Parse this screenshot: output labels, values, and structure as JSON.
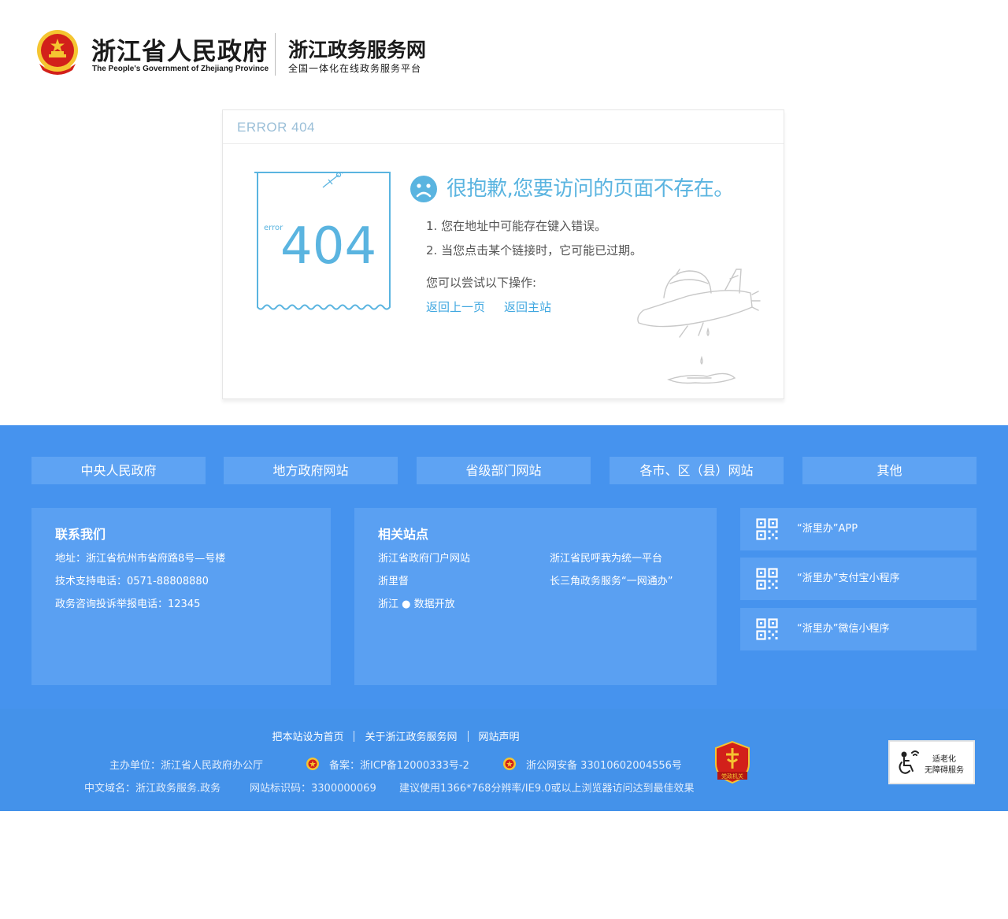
{
  "header": {
    "gov_title": "浙江省人民政府",
    "gov_subtitle": "The People's Government of Zhejiang Province",
    "portal_title": "浙江政务服务网",
    "portal_subtitle": "全国一体化在线政务服务平台"
  },
  "error": {
    "header_label": "ERROR 404",
    "ticket_small": "error",
    "ticket_code": "404",
    "headline": "很抱歉,您要访问的页面不存在。",
    "tip1": "1. 您在地址中可能存在键入错误。",
    "tip2": "2. 当您点击某个链接时，它可能已过期。",
    "try_label": "您可以尝试以下操作:",
    "link_back": "返回上一页",
    "link_home": "返回主站"
  },
  "footer": {
    "nav": [
      "中央人民政府",
      "地方政府网站",
      "省级部门网站",
      "各市、区（县）网站",
      "其他"
    ],
    "contact": {
      "title": "联系我们",
      "address": "地址：浙江省杭州市省府路8号—号楼",
      "support_phone": "技术支持电话：0571-88808880",
      "complaint_phone": "政务咨询投诉举报电话：12345"
    },
    "sites": {
      "title": "相关站点",
      "items": [
        "浙江省政府门户网站",
        "浙江省民呼我为统一平台",
        "浙里督",
        "长三角政务服务“一网通办”",
        "浙江 ● 数据开放"
      ]
    },
    "apps": [
      "“浙里办”APP",
      "“浙里办”支付宝小程序",
      "“浙里办”微信小程序"
    ],
    "bottom_links": [
      "把本站设为首页",
      "关于浙江政务服务网",
      "网站声明"
    ],
    "sponsor": "主办单位：浙江省人民政府办公厅",
    "icp": "备案：浙ICP备12000333号-2",
    "police": "浙公网安备 33010602004556号",
    "domain": "中文域名：浙江政务服务.政务",
    "site_code": "网站标识码：3300000069",
    "recommend": "建议使用1366*768分辨率/IE9.0或以上浏览器访问达到最佳效果",
    "party_badge_text": "党政机关",
    "access_line1": "适老化",
    "access_line2": "无障碍服务"
  },
  "colors": {
    "accent_blue": "#5ab4e0",
    "footer_blue": "#4693ee",
    "panel_blue": "#5aa0f2",
    "emblem_red": "#d2201a",
    "emblem_gold": "#f5c531"
  },
  "icons": [
    "national-emblem-icon",
    "sad-face-icon",
    "rocket-illustration",
    "qr-code-icon",
    "police-badge-icon",
    "party-badge-icon",
    "accessibility-icon"
  ]
}
